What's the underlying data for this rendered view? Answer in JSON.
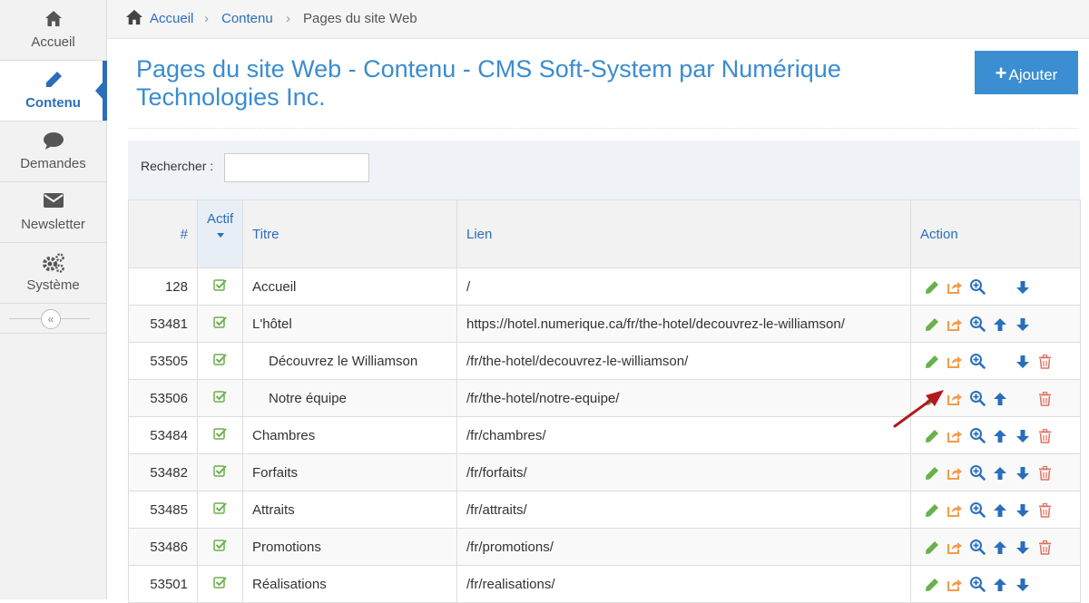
{
  "sidebar": {
    "items": [
      {
        "label": "Accueil",
        "icon": "home-icon"
      },
      {
        "label": "Contenu",
        "icon": "pencil-icon",
        "active": true
      },
      {
        "label": "Demandes",
        "icon": "comment-icon"
      },
      {
        "label": "Newsletter",
        "icon": "envelope-icon"
      },
      {
        "label": "Système",
        "icon": "gears-icon"
      }
    ],
    "collapse_glyph": "«"
  },
  "breadcrumb": {
    "home": "Accueil",
    "section": "Contenu",
    "current": "Pages du site Web",
    "sep": "›"
  },
  "page": {
    "title": "Pages du site Web - Contenu - CMS Soft-System par Numérique Technologies Inc.",
    "add_label": "Ajouter",
    "add_plus": "+"
  },
  "search": {
    "label": "Rechercher :",
    "value": ""
  },
  "table": {
    "headers": {
      "num": "#",
      "actif": "Actif",
      "titre": "Titre",
      "lien": "Lien",
      "action": "Action"
    },
    "rows": [
      {
        "id": "128",
        "titre": "Accueil",
        "lien": "/",
        "indent": false,
        "up": false,
        "down": true,
        "del": false
      },
      {
        "id": "53481",
        "titre": "L'hôtel",
        "lien": "https://hotel.numerique.ca/fr/the-hotel/decouvrez-le-williamson/",
        "indent": false,
        "up": true,
        "down": true,
        "del": false
      },
      {
        "id": "53505",
        "titre": "Découvrez le Williamson",
        "lien": "/fr/the-hotel/decouvrez-le-williamson/",
        "indent": true,
        "up": false,
        "down": true,
        "del": true
      },
      {
        "id": "53506",
        "titre": "Notre équipe",
        "lien": "/fr/the-hotel/notre-equipe/",
        "indent": true,
        "up": true,
        "down": false,
        "del": true
      },
      {
        "id": "53484",
        "titre": "Chambres",
        "lien": "/fr/chambres/",
        "indent": false,
        "up": true,
        "down": true,
        "del": true
      },
      {
        "id": "53482",
        "titre": "Forfaits",
        "lien": "/fr/forfaits/",
        "indent": false,
        "up": true,
        "down": true,
        "del": true
      },
      {
        "id": "53485",
        "titre": "Attraits",
        "lien": "/fr/attraits/",
        "indent": false,
        "up": true,
        "down": true,
        "del": true
      },
      {
        "id": "53486",
        "titre": "Promotions",
        "lien": "/fr/promotions/",
        "indent": false,
        "up": true,
        "down": true,
        "del": true
      },
      {
        "id": "53501",
        "titre": "Réalisations",
        "lien": "/fr/realisations/",
        "indent": false,
        "up": true,
        "down": true,
        "del": false
      }
    ]
  },
  "colors": {
    "accent": "#2a6ebb",
    "title": "#3b8ccf",
    "edit": "#6ab04c",
    "share": "#f39c4a",
    "zoom": "#2a6ebb",
    "delete": "#e07060",
    "annotation": "#b3171f"
  }
}
